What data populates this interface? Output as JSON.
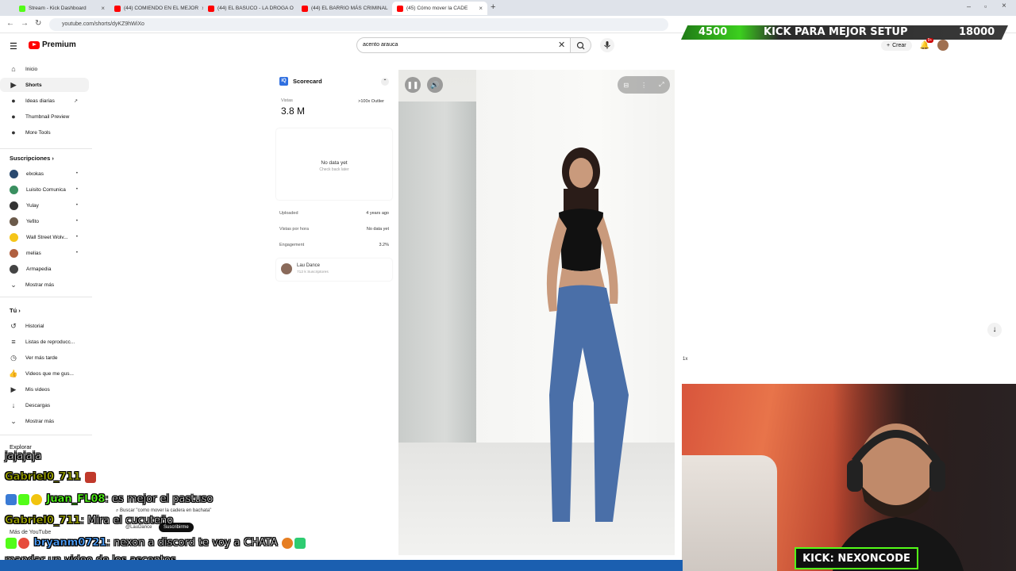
{
  "browser": {
    "tabs": [
      {
        "label": "Stream - Kick Dashboard",
        "color": "#53fc18"
      },
      {
        "label": "(44) COMIENDO EN EL MEJOR",
        "color": "#ff0000"
      },
      {
        "label": "(44) EL BASUCO - LA DROGA O",
        "color": "#ff0000"
      },
      {
        "label": "(44) EL BARRIO MÁS CRIMINAL",
        "color": "#ff0000"
      },
      {
        "label": "(45) Cómo mover la CADE",
        "color": "#ff0000"
      }
    ],
    "url": "youtube.com/shorts/dyKZ9hWiXo"
  },
  "kick_banner": {
    "left": "4500",
    "middle": "KICK PARA MEJOR SETUP",
    "right": "18000"
  },
  "youtube": {
    "logo": "Premium",
    "search": {
      "value": "acento arauca"
    },
    "create_label": "Crear",
    "notif_count": "9+"
  },
  "sidebar": {
    "top": [
      {
        "label": "Inicio",
        "icon": "home-icon"
      },
      {
        "label": "Shorts",
        "icon": "shorts-icon"
      },
      {
        "label": "Ideas diarias",
        "icon": "bulb-icon"
      },
      {
        "label": "Thumbnail Preview",
        "icon": "preview-icon"
      },
      {
        "label": "More Tools",
        "icon": "tools-icon"
      }
    ],
    "subs_title": "Suscripciones",
    "subs": [
      {
        "label": "elxokas",
        "color": "#2a4a70"
      },
      {
        "label": "Luisito Comunica",
        "color": "#3a8f60"
      },
      {
        "label": "Yulay",
        "color": "#333333"
      },
      {
        "label": "Yefito",
        "color": "#6b5a4a"
      },
      {
        "label": "Wall Street Wolv...",
        "color": "#f5c518"
      },
      {
        "label": "melias",
        "color": "#b06040"
      },
      {
        "label": "Armapedia",
        "color": "#444444"
      }
    ],
    "subs_more": "Mostrar más",
    "you_title": "Tú",
    "you": [
      {
        "label": "Historial"
      },
      {
        "label": "Listas de reproducc..."
      },
      {
        "label": "Ver más tarde"
      },
      {
        "label": "Videos que me gus..."
      },
      {
        "label": "Mis videos"
      },
      {
        "label": "Descargas"
      },
      {
        "label": "Mostrar más"
      }
    ],
    "explore_title": "Explorar"
  },
  "scorecard": {
    "title": "Scorecard",
    "views_label": "Vistas",
    "views": "3.8 M",
    "outlier": ">100x Outlier",
    "empty_title": "No data yet",
    "empty_sub": "Check back later",
    "rows": [
      {
        "label": "Uploaded",
        "value": "4 years ago"
      },
      {
        "label": "Vistas por hora",
        "value": "No data yet"
      },
      {
        "label": "Engagement",
        "value": "3.2%"
      }
    ],
    "channel_name": "Lau Dance",
    "channel_subs": "712 k Suscriptores"
  },
  "speed_label": "1x",
  "video_overlay": {
    "search_hint": "Buscar \"como mover la cadera en bachata\"",
    "channel_handle": "@LauDance",
    "subscribe": "Suscribirme",
    "more_yt": "Más de YouTube"
  },
  "chat": [
    {
      "user": "",
      "msg": "jajajaja"
    },
    {
      "user": "Gabriel0_711",
      "msg": ""
    },
    {
      "user": "Juan_FL08",
      "msg": ": es mejor el pastuso"
    },
    {
      "user": "Gabriel0_711",
      "msg": ": Mira el cucuteño"
    },
    {
      "user": "bryanm0721",
      "msg": ": nexon a discord te voy a",
      "extra": "CHATA"
    },
    {
      "user": "",
      "msg": "mandar un video de los ascentos"
    }
  ],
  "kick_tag": "KICK: NEXONCODE"
}
